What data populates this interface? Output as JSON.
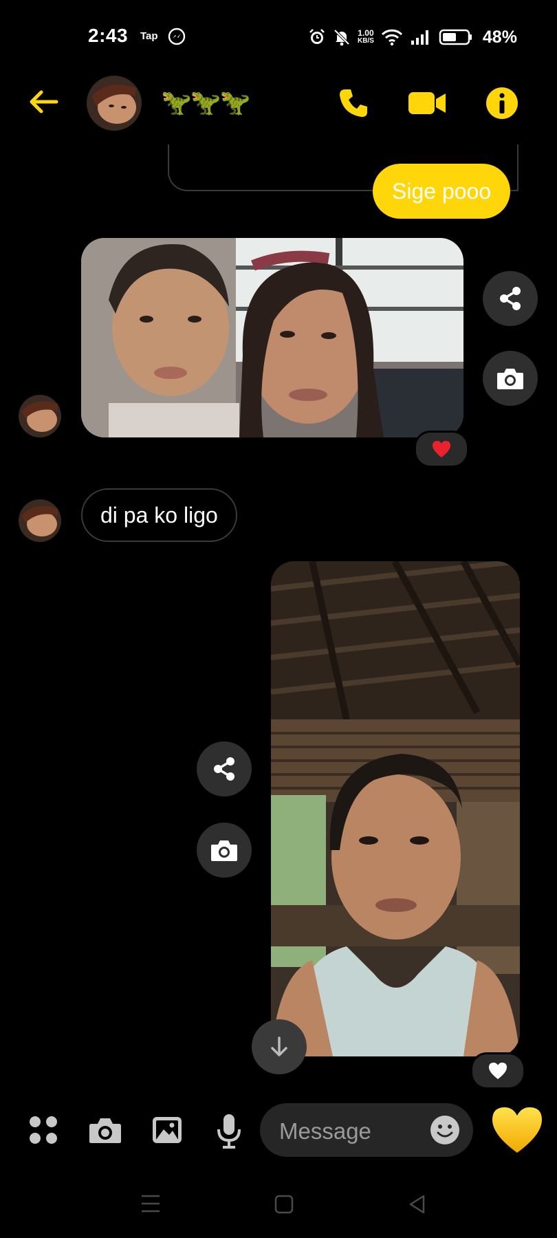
{
  "status_bar": {
    "time": "2:43",
    "app_label": "Tap",
    "net_speed_value": "1.00",
    "net_speed_unit": "KB/S",
    "battery": "48%"
  },
  "header": {
    "chat_name": "🦖🦖🦖",
    "accent_color": "#ffd60a"
  },
  "messages": [
    {
      "type": "sent_text",
      "text": "Sige pooo"
    },
    {
      "type": "received_image",
      "reaction": "heart-red"
    },
    {
      "type": "received_text",
      "text": "di pa ko ligo"
    },
    {
      "type": "sent_image",
      "reaction": "heart-white"
    }
  ],
  "composer": {
    "placeholder": "Message",
    "like_emoji": "💛"
  },
  "icons": [
    "back-arrow-icon",
    "phone-icon",
    "video-icon",
    "info-icon",
    "share-icon",
    "camera-icon",
    "menu-grid-icon",
    "gallery-icon",
    "mic-icon",
    "emoji-icon",
    "scroll-down-icon"
  ]
}
